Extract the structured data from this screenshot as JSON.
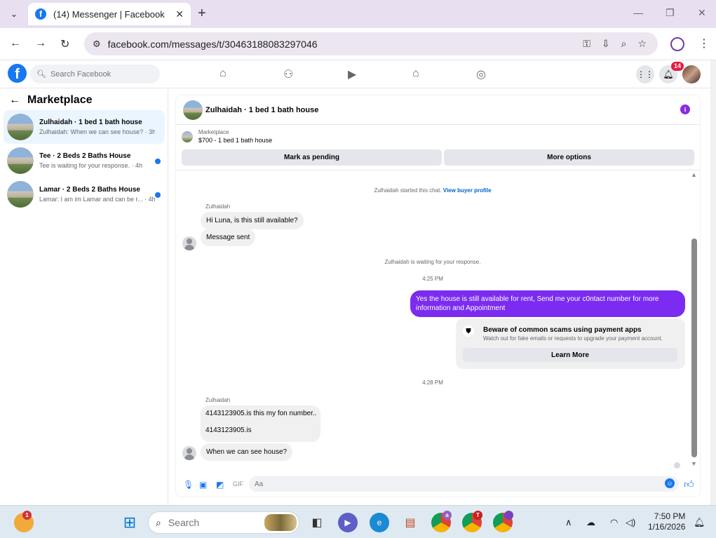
{
  "browser": {
    "tab_title": "(14) Messenger | Facebook",
    "url": "facebook.com/messages/t/30463188083297046"
  },
  "facebook": {
    "search_placeholder": "Search Facebook",
    "notification_count": "14",
    "icons": [
      "home-icon",
      "friends-icon",
      "watch-icon",
      "marketplace-icon",
      "groups-icon",
      "menu-grid-icon",
      "bell-icon"
    ]
  },
  "sidebar": {
    "title": "Marketplace",
    "conversations": [
      {
        "name": "Zulhaidah · 1 bed 1 bath house",
        "snippet": "Zulhaidah: When we can see house? · 3h",
        "unread": false,
        "active": true
      },
      {
        "name": "Tee · 2 Beds 2 Baths House",
        "snippet": "Tee is waiting for your response. · 4h",
        "unread": true,
        "active": false
      },
      {
        "name": "Lamar · 2 Beds 2 Baths House",
        "snippet": "Lamar: I am im Lamar and can be r...",
        "time": "· 4h",
        "unread": true,
        "active": false
      }
    ]
  },
  "chat": {
    "title": "Zulhaidah · 1 bed 1 bath house",
    "listing_label": "Marketplace",
    "listing_value": "$700 - 1 bed 1 bath house",
    "mark_pending": "Mark as pending",
    "more_options": "More options",
    "started_text": "Zulhaidah started this chat.",
    "view_profile": "View buyer profile",
    "sender1": "Zulhaidah",
    "msg1": "Hi Luna, is this still available?",
    "msg2": "Message sent",
    "waiting_text": "Zulhaidah is waiting for your response.",
    "time1": "4:25 PM",
    "out_msg": "Yes the house is still available for rent, Send me your c0ntact number for more information and Appointment",
    "scam_title": "Beware of common scams using payment apps",
    "scam_desc": "Watch out for fake emails or requests to upgrade your payment account.",
    "learn_more": "Learn More",
    "time2": "4:28 PM",
    "sender2": "Zulhaidah",
    "msg3_line1": "4143123905.is this my fon number..",
    "msg3_line2": "4143123905.is",
    "msg4": "When we can see house?",
    "composer_placeholder": "Aa"
  },
  "taskbar": {
    "search_placeholder": "Search",
    "time": "7:50 PM",
    "date": "1/16/2026",
    "badge_first": "1",
    "badge_a": "a",
    "badge_t": "T"
  },
  "colors": {
    "facebook_blue": "#1877f2",
    "outgoing_bubble": "#7b2cf0",
    "notification_red": "#e41e3f"
  }
}
